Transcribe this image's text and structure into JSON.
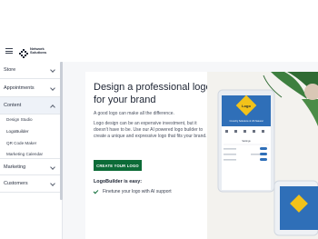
{
  "header": {
    "brand_line1": "Network",
    "brand_line2": "Solutions"
  },
  "sidebar": {
    "items": [
      {
        "label": "Store"
      },
      {
        "label": "Appointments"
      },
      {
        "label": "Content"
      },
      {
        "label": "Marketing"
      },
      {
        "label": "Customers"
      }
    ],
    "content_sub_items": [
      {
        "label": "Design Studio"
      },
      {
        "label": "LogoBuilder"
      },
      {
        "label": "QR Code Maker"
      },
      {
        "label": "Marketing Calendar"
      }
    ]
  },
  "main": {
    "title": "Design a professional logo for your brand",
    "lead": "A good logo can make all the difference.",
    "body": "Logo design can be an expensive investment, but it doesn't have to be. Use our AI powered logo builder to create a unique and expressive logo that fits your brand.",
    "create_button": "CREATE YOUR LOGO",
    "easy_title": "LogoBuilder is easy:",
    "features": [
      {
        "label": "Finetune your logo with AI support"
      }
    ]
  },
  "hero": {
    "logo_text": "Logo",
    "brand_text": "Crunchy Solutions & US Natural",
    "tab_label": "Settings",
    "colors": {
      "leaf": "#3d7f3f",
      "tablet_frame": "#e9edf2",
      "tablet_header": "#2f6fb8",
      "logo_yellow": "#f2c21a"
    }
  },
  "colors": {
    "accent_green": "#0c6b37",
    "border": "#e3e6eb",
    "panel_bg": "#f6f7f9"
  }
}
